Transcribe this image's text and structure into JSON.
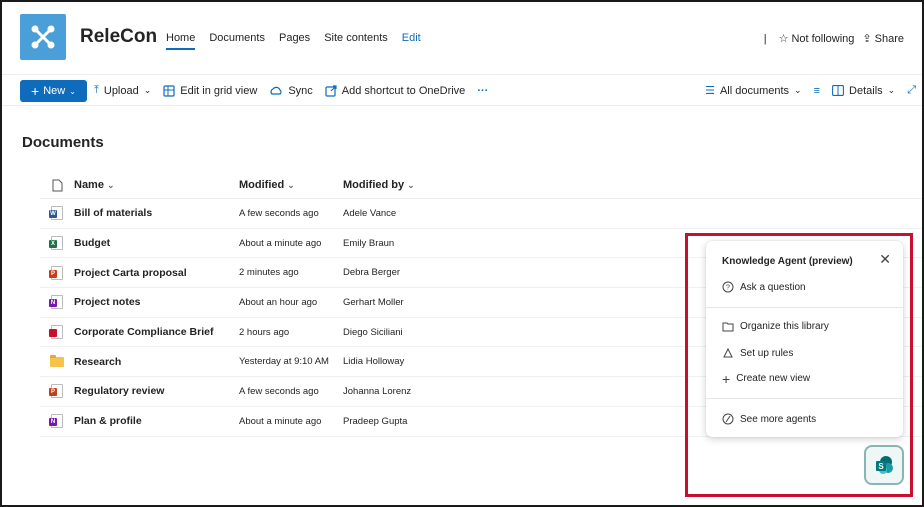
{
  "site": {
    "name": "ReleCon",
    "nav": [
      "Home",
      "Documents",
      "Pages",
      "Site contents",
      "Edit"
    ],
    "follow_label": "Not following",
    "share_label": "Share"
  },
  "commandbar": {
    "new_label": "New",
    "upload_label": "Upload",
    "grid_label": "Edit in grid view",
    "sync_label": "Sync",
    "shortcut_label": "Add shortcut to OneDrive",
    "more_label": "···",
    "view_label": "All documents",
    "details_label": "Details"
  },
  "library": {
    "title": "Documents",
    "columns": {
      "name": "Name",
      "modified": "Modified",
      "modified_by": "Modified by"
    },
    "rows": [
      {
        "type": "word",
        "name": "Bill of materials",
        "modified": "A few seconds ago",
        "modified_by": "Adele Vance"
      },
      {
        "type": "excel",
        "name": "Budget",
        "modified": "About a minute ago",
        "modified_by": "Emily Braun"
      },
      {
        "type": "powerpoint",
        "name": "Project Carta proposal",
        "modified": "2 minutes ago",
        "modified_by": "Debra Berger"
      },
      {
        "type": "onenote",
        "name": "Project notes",
        "modified": "About an hour ago",
        "modified_by": "Gerhart Moller"
      },
      {
        "type": "pdf",
        "name": "Corporate Compliance Brief",
        "modified": "2 hours ago",
        "modified_by": "Diego Siciliani"
      },
      {
        "type": "folder",
        "name": "Research",
        "modified": "Yesterday at 9:10 AM",
        "modified_by": "Lidia Holloway"
      },
      {
        "type": "powerpoint",
        "name": "Regulatory review",
        "modified": "A few seconds ago",
        "modified_by": "Johanna Lorenz"
      },
      {
        "type": "onenote",
        "name": "Plan & profile",
        "modified": "About a minute ago",
        "modified_by": "Pradeep Gupta"
      }
    ]
  },
  "agent_panel": {
    "title": "Knowledge Agent (preview)",
    "ask": "Ask a question",
    "organize": "Organize this library",
    "rules": "Set up rules",
    "create_view": "Create new view",
    "see_more": "See more agents"
  },
  "colors": {
    "accent": "#0f6cbd",
    "logo": "#4a9fd8",
    "highlight": "#c8102e",
    "word": "#2b5797",
    "excel": "#1e7145",
    "powerpoint": "#c43e1c",
    "onenote": "#7719aa",
    "pdf": "#c8102e"
  }
}
